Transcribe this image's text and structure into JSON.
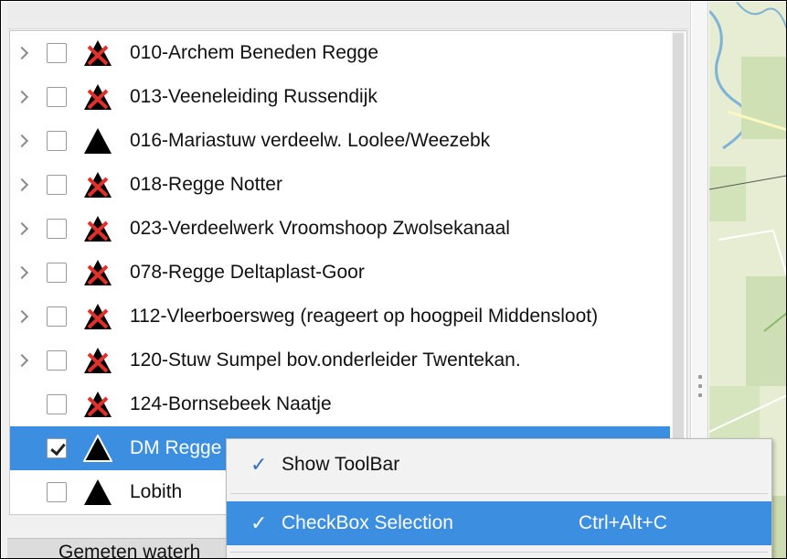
{
  "tree": {
    "items": [
      {
        "label": "010-Archem Beneden Regge",
        "expandable": true,
        "checked": false,
        "icon": "red-x-warning-triangle-icon"
      },
      {
        "label": "013-Veeneleiding Russendijk",
        "expandable": true,
        "checked": false,
        "icon": "red-x-warning-triangle-icon"
      },
      {
        "label": "016-Mariastuw verdeelw. Loolee/Weezebk",
        "expandable": true,
        "checked": false,
        "icon": "black-triangle-icon"
      },
      {
        "label": "018-Regge Notter",
        "expandable": true,
        "checked": false,
        "icon": "red-x-warning-triangle-icon"
      },
      {
        "label": "023-Verdeelwerk Vroomshoop Zwolsekanaal",
        "expandable": true,
        "checked": false,
        "icon": "red-x-warning-triangle-icon"
      },
      {
        "label": "078-Regge Deltaplast-Goor",
        "expandable": true,
        "checked": false,
        "icon": "red-x-warning-triangle-icon"
      },
      {
        "label": "112-Vleerboersweg (reageert op hoogpeil Middensloot)",
        "expandable": true,
        "checked": false,
        "icon": "red-x-warning-triangle-icon"
      },
      {
        "label": "120-Stuw Sumpel bov.onderleider  Twentekan.",
        "expandable": true,
        "checked": false,
        "icon": "red-x-warning-triangle-icon"
      },
      {
        "label": "124-Bornsebeek Naatje",
        "expandable": false,
        "checked": false,
        "icon": "red-x-warning-triangle-icon"
      },
      {
        "label": "DM Regge",
        "expandable": false,
        "checked": true,
        "selected": true,
        "icon": "black-triangle-icon"
      },
      {
        "label": "Lobith",
        "expandable": false,
        "checked": false,
        "icon": "black-triangle-icon"
      }
    ]
  },
  "bottom": {
    "label": "Gemeten waterh"
  },
  "context_menu": {
    "items": [
      {
        "label": "Show ToolBar",
        "checked": true,
        "shortcut": ""
      },
      {
        "label": "CheckBox Selection",
        "checked": true,
        "shortcut": "Ctrl+Alt+C",
        "highlighted": true
      }
    ]
  },
  "colors": {
    "selection": "#3c8ee0",
    "warning_red": "#e0302a",
    "check_blue": "#2f6fc4"
  }
}
